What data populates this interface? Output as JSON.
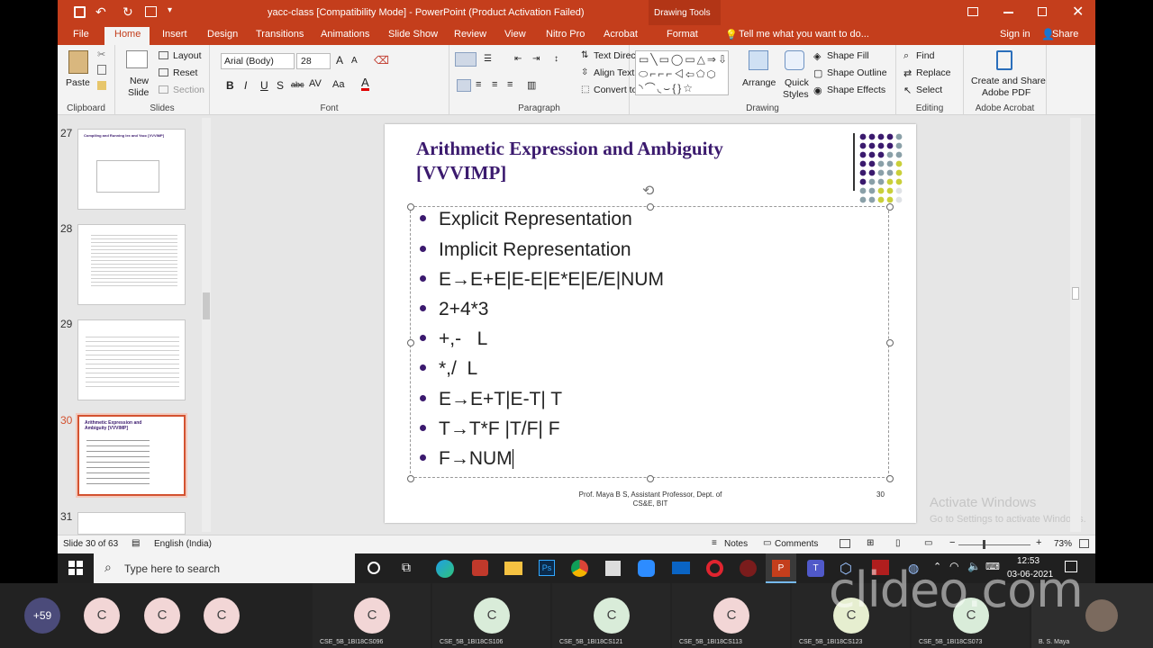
{
  "window": {
    "title": "yacc-class [Compatibility Mode] - PowerPoint (Product Activation Failed)",
    "context_tab": "Drawing Tools"
  },
  "tabs": [
    "File",
    "Home",
    "Insert",
    "Design",
    "Transitions",
    "Animations",
    "Slide Show",
    "Review",
    "View",
    "Nitro Pro",
    "Acrobat",
    "Format"
  ],
  "tell_me": "Tell me what you want to do...",
  "sign_in": "Sign in",
  "share": "Share",
  "ribbon": {
    "clipboard": {
      "label": "Clipboard",
      "paste": "Paste"
    },
    "slides": {
      "label": "Slides",
      "new_slide": "New",
      "new_slide2": "Slide",
      "layout": "Layout",
      "reset": "Reset",
      "section": "Section"
    },
    "font": {
      "label": "Font",
      "font_name": "Arial (Body)",
      "font_size": "28",
      "bold": "B",
      "italic": "I",
      "underline": "U",
      "shadow": "S",
      "strike": "abc",
      "case": "Aa"
    },
    "paragraph": {
      "label": "Paragraph",
      "text_direction": "Text Direction",
      "align_text": "Align Text",
      "smartart": "Convert to SmartArt"
    },
    "drawing": {
      "label": "Drawing",
      "arrange": "Arrange",
      "quick_styles": "Quick",
      "quick_styles2": "Styles",
      "shape_fill": "Shape Fill",
      "shape_outline": "Shape Outline",
      "shape_effects": "Shape Effects"
    },
    "editing": {
      "label": "Editing",
      "find": "Find",
      "replace": "Replace",
      "select": "Select"
    },
    "acrobat": {
      "label": "Adobe Acrobat",
      "create": "Create and Share",
      "create2": "Adobe PDF"
    }
  },
  "thumbnails": [
    {
      "num": "27",
      "title": "Compiling and Running lex and Yacc [VVVIMP]"
    },
    {
      "num": "28",
      "title": ""
    },
    {
      "num": "29",
      "title": ""
    },
    {
      "num": "30",
      "title": "Arithmetic Expression and Ambiguity [VVVIMP]",
      "selected": true
    },
    {
      "num": "31",
      "title": ""
    }
  ],
  "slide": {
    "title_line1": "Arithmetic Expression and Ambiguity",
    "title_line2": "[VVVIMP]",
    "bullets": [
      "Explicit Representation",
      "Implicit Representation",
      "E→E+E|E-E|E*E|E/E|NUM",
      "2+4*3",
      "+,-   L",
      "*,/  L",
      "E→E+T|E-T| T",
      "T→T*F |T/F| F",
      "F→NUM"
    ],
    "footer_line1": "Prof. Maya B S, Assistant Professor, Dept. of",
    "footer_line2": "CS&E, BIT",
    "page_number": "30"
  },
  "watermark": {
    "line1": "Activate Windows",
    "line2": "Go to Settings to activate Windows."
  },
  "status": {
    "slide_of": "Slide 30 of 63",
    "language": "English (India)",
    "notes": "Notes",
    "comments": "Comments",
    "zoom": "73%"
  },
  "taskbar": {
    "search_placeholder": "Type here to search",
    "time": "12:53",
    "date": "03-06-2021"
  },
  "meeting": {
    "overflow": "+59",
    "avatars": [
      "C",
      "C",
      "C"
    ],
    "tiles": [
      {
        "initial": "C",
        "name": "CSE_5B_1BI18CS096"
      },
      {
        "initial": "C",
        "name": "CSE_5B_1BI18CS106"
      },
      {
        "initial": "C",
        "name": "CSE_5B_1BI18CS121"
      },
      {
        "initial": "C",
        "name": "CSE_5B_1BI18CS113"
      },
      {
        "initial": "C",
        "name": "CSE_5B_1BI18CS123"
      },
      {
        "initial": "C",
        "name": "CSE_5B_1BI18CS073"
      }
    ],
    "presenter": "B. S. Maya"
  },
  "clideo": "clideo.com",
  "colors": {
    "accent": "#c43e1c",
    "title": "#3b1a6e",
    "selected_thumb": "#d35230"
  }
}
